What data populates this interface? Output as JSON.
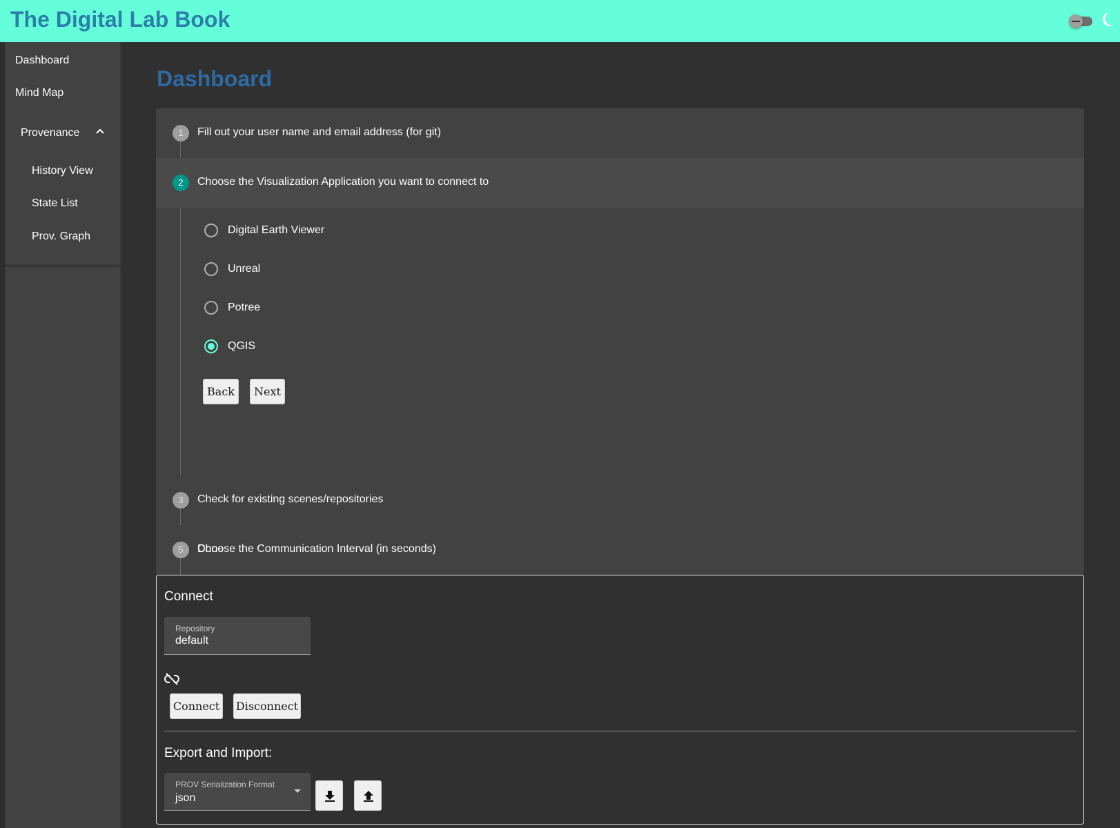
{
  "app": {
    "title": "The Digital Lab Book"
  },
  "sidebar": {
    "items": [
      {
        "label": "Dashboard"
      },
      {
        "label": "Mind Map"
      }
    ],
    "group": {
      "label": "Provenance",
      "expanded": true,
      "children": [
        {
          "label": "History View"
        },
        {
          "label": "State List"
        },
        {
          "label": "Prov. Graph"
        }
      ]
    }
  },
  "main": {
    "title": "Dashboard",
    "stepper": {
      "active_step": 2,
      "steps": [
        {
          "num": "1",
          "label": "Fill out your user name and email address (for git)"
        },
        {
          "num": "2",
          "label": "Choose the Visualization Application you want to connect to"
        },
        {
          "num": "3",
          "label": "Check for existing scenes/repositories"
        },
        {
          "num": "4",
          "label": "Choose the Communication Interval (in seconds)"
        },
        {
          "num": "5",
          "label": "Done"
        }
      ],
      "options": [
        {
          "label": "Digital Earth Viewer",
          "checked": false
        },
        {
          "label": "Unreal",
          "checked": false
        },
        {
          "label": "Potree",
          "checked": false
        },
        {
          "label": "QGIS",
          "checked": true
        }
      ],
      "back_label": "Back",
      "next_label": "Next"
    },
    "connect": {
      "title": "Connect",
      "repository_label": "Repository",
      "repository_value": "default",
      "status_icon": "link-off-icon",
      "connect_label": "Connect",
      "disconnect_label": "Disconnect",
      "export_title": "Export and Import:",
      "format_label": "PROV Serialization Format",
      "format_value": "json",
      "download_icon": "download-icon",
      "upload_icon": "upload-icon"
    }
  },
  "colors": {
    "appbar": "#64ffda",
    "title": "#2c7fa8",
    "page_title": "#2f6aa3",
    "active_step": "#009688",
    "radio_checked": "#64ffda"
  }
}
